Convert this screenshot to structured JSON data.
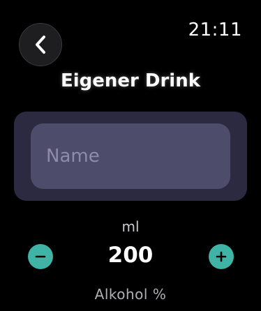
{
  "header": {
    "time": "21:11",
    "title": "Eigener Drink",
    "back_icon": "chevron-left-icon"
  },
  "form": {
    "name": {
      "value": "",
      "placeholder": "Name"
    },
    "volume": {
      "label": "ml",
      "value": "200",
      "decrement_icon": "minus-circle-icon",
      "increment_icon": "plus-circle-icon"
    },
    "alcohol": {
      "label": "Alkohol %"
    }
  },
  "colors": {
    "background": "#000000",
    "card": "#2b2a40",
    "input": "#4e4c6b",
    "accent": "#3eb3a6"
  }
}
